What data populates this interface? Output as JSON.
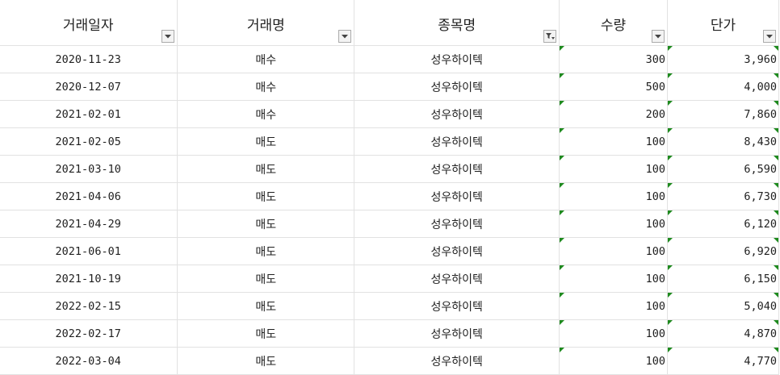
{
  "columns": [
    {
      "label": "거래일자",
      "filter_active": false
    },
    {
      "label": "거래명",
      "filter_active": false
    },
    {
      "label": "종목명",
      "filter_active": true
    },
    {
      "label": "수량",
      "filter_active": false
    },
    {
      "label": "단가",
      "filter_active": false
    }
  ],
  "rows": [
    {
      "date": "2020-11-23",
      "type": "매수",
      "name": "성우하이텍",
      "qty": "300",
      "price": "3,960"
    },
    {
      "date": "2020-12-07",
      "type": "매수",
      "name": "성우하이텍",
      "qty": "500",
      "price": "4,000"
    },
    {
      "date": "2021-02-01",
      "type": "매수",
      "name": "성우하이텍",
      "qty": "200",
      "price": "7,860"
    },
    {
      "date": "2021-02-05",
      "type": "매도",
      "name": "성우하이텍",
      "qty": "100",
      "price": "8,430"
    },
    {
      "date": "2021-03-10",
      "type": "매도",
      "name": "성우하이텍",
      "qty": "100",
      "price": "6,590"
    },
    {
      "date": "2021-04-06",
      "type": "매도",
      "name": "성우하이텍",
      "qty": "100",
      "price": "6,730"
    },
    {
      "date": "2021-04-29",
      "type": "매도",
      "name": "성우하이텍",
      "qty": "100",
      "price": "6,120"
    },
    {
      "date": "2021-06-01",
      "type": "매도",
      "name": "성우하이텍",
      "qty": "100",
      "price": "6,920"
    },
    {
      "date": "2021-10-19",
      "type": "매도",
      "name": "성우하이텍",
      "qty": "100",
      "price": "6,150"
    },
    {
      "date": "2022-02-15",
      "type": "매도",
      "name": "성우하이텍",
      "qty": "100",
      "price": "5,040"
    },
    {
      "date": "2022-02-17",
      "type": "매도",
      "name": "성우하이텍",
      "qty": "100",
      "price": "4,870"
    },
    {
      "date": "2022-03-04",
      "type": "매도",
      "name": "성우하이텍",
      "qty": "100",
      "price": "4,770"
    }
  ],
  "colors": {
    "grid": "#e2e2e2",
    "error_indicator": "#1e8a1e",
    "text": "#1f1f1f"
  },
  "icons": {
    "filter_button": "dropdown-arrow-icon",
    "active_filter_button": "filter-funnel-icon",
    "cell_indicator": "green-triangle-icon"
  }
}
